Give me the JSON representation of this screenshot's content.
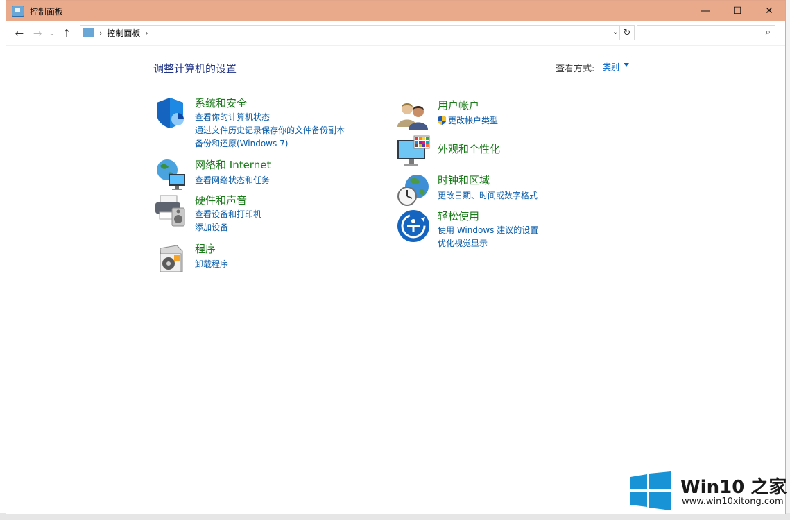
{
  "window": {
    "title": "控制面板",
    "minimize": "—",
    "maximize": "☐",
    "close": "✕"
  },
  "nav": {
    "back": "←",
    "forward": "→",
    "recent": "⌄",
    "up": "↑",
    "breadcrumb": "控制面板",
    "refresh": "↻",
    "search_placeholder": ""
  },
  "main": {
    "heading": "调整计算机的设置",
    "view_label": "查看方式:",
    "view_value": "类别"
  },
  "categories_left": [
    {
      "title": "系统和安全",
      "links": [
        "查看你的计算机状态",
        "通过文件历史记录保存你的文件备份副本",
        "备份和还原(Windows 7)"
      ],
      "icon": "shield-icon"
    },
    {
      "title": "网络和 Internet",
      "links": [
        "查看网络状态和任务"
      ],
      "icon": "network-globe-icon"
    },
    {
      "title": "硬件和声音",
      "links": [
        "查看设备和打印机",
        "添加设备"
      ],
      "icon": "printer-speaker-icon"
    },
    {
      "title": "程序",
      "links": [
        "卸载程序"
      ],
      "icon": "programs-disc-icon"
    }
  ],
  "categories_right": [
    {
      "title": "用户帐户",
      "links": [
        "更改帐户类型"
      ],
      "icon": "users-icon"
    },
    {
      "title": "外观和个性化",
      "links": [],
      "icon": "monitor-palette-icon"
    },
    {
      "title": "时钟和区域",
      "links": [
        "更改日期、时间或数字格式"
      ],
      "icon": "clock-globe-icon"
    },
    {
      "title": "轻松使用",
      "links": [
        "使用 Windows 建议的设置",
        "优化视觉显示"
      ],
      "icon": "ease-of-access-icon"
    }
  ],
  "watermark": {
    "title": "Win10 之家",
    "url": "www.win10xitong.com"
  },
  "colors": {
    "titlebar": "#e9a98b",
    "heading": "#1e3287",
    "category_title": "#1a7a1a",
    "link": "#0b5eaa"
  }
}
